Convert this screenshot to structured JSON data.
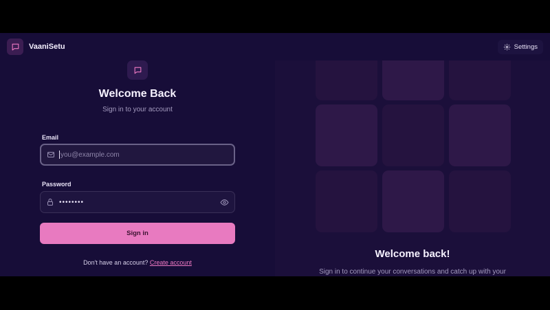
{
  "app": {
    "name": "VaaniSetu",
    "logo_icon": "message-square-icon"
  },
  "header": {
    "settings_label": "Settings",
    "settings_icon": "gear-icon"
  },
  "login": {
    "title": "Welcome Back",
    "subtitle": "Sign in to your account",
    "email_label": "Email",
    "email_placeholder": "you@example.com",
    "email_value": "",
    "password_label": "Password",
    "password_value": "••••••••",
    "signin_label": "Sign in",
    "signup_prompt": "Don't have an account?",
    "signup_link": "Create account"
  },
  "promo": {
    "title": "Welcome back!",
    "text": "Sign in to continue your conversations and catch up with your"
  },
  "colors": {
    "accent": "#e87ac0",
    "background": "#150c34",
    "tile_light": "#2e1848",
    "tile_dark": "#25133f"
  }
}
